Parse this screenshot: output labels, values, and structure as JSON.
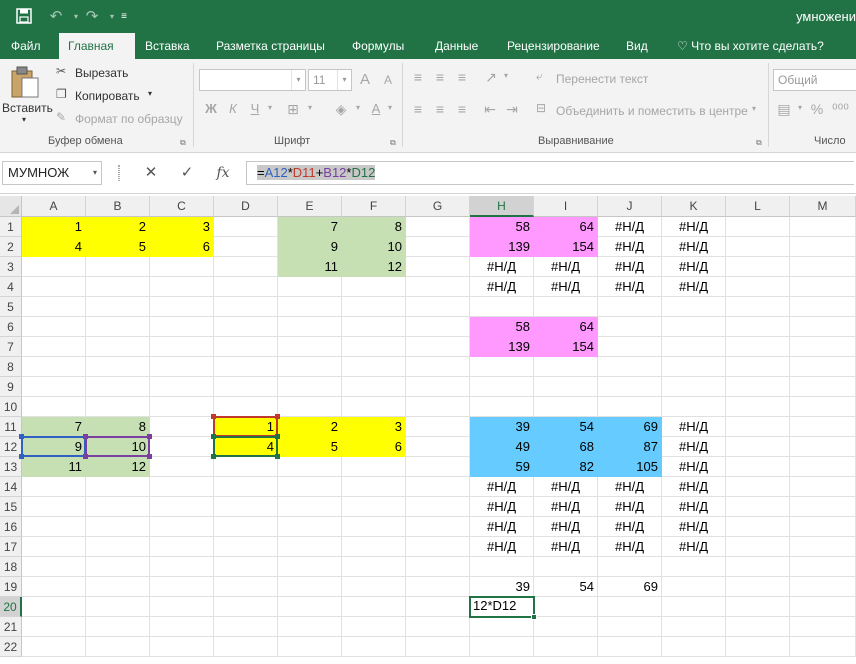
{
  "app": {
    "title": "умножени",
    "colors": {
      "accent": "#217346",
      "yellow": "#ffff00",
      "green": "#c6e0b4",
      "pink": "#ff99ff",
      "blue": "#66ccff"
    }
  },
  "qat": {
    "save_icon": "save-icon",
    "undo_icon": "undo-icon",
    "redo_icon": "redo-icon",
    "customize_icon": "customize-qat-icon"
  },
  "tabs": [
    "Файл",
    "Главная",
    "Вставка",
    "Разметка страницы",
    "Формулы",
    "Данные",
    "Рецензирование",
    "Вид"
  ],
  "tell_me": "Что вы хотите сделать?",
  "ribbon": {
    "clipboard": {
      "paste": "Вставить",
      "cut": "Вырезать",
      "copy": "Копировать",
      "format_painter": "Формат по образцу",
      "label": "Буфер обмена"
    },
    "font": {
      "name": "",
      "size": "11",
      "bold": "Ж",
      "italic": "К",
      "underline": "Ч",
      "grow": "A",
      "shrink": "A",
      "color": "A",
      "label": "Шрифт"
    },
    "alignment": {
      "wrap": "Перенести текст",
      "merge": "Объединить и поместить в центре",
      "label": "Выравнивание"
    },
    "number": {
      "format": "Общий",
      "percent": "%",
      "label": "Число"
    }
  },
  "formula_bar": {
    "name_box": "МУМНОЖ",
    "cancel": "✕",
    "enter": "✓",
    "fx": "fx",
    "formula_parts": [
      {
        "text": "=",
        "color": "#000000"
      },
      {
        "text": "A12",
        "color": "#3060c0"
      },
      {
        "text": "*",
        "color": "#000000"
      },
      {
        "text": "D11",
        "color": "#c0392b"
      },
      {
        "text": "+",
        "color": "#000000"
      },
      {
        "text": "B12",
        "color": "#7a3fa0"
      },
      {
        "text": "*",
        "color": "#000000"
      },
      {
        "text": "D12",
        "color": "#217346"
      }
    ]
  },
  "sheet": {
    "columns": [
      "A",
      "B",
      "C",
      "D",
      "E",
      "F",
      "G",
      "H",
      "I",
      "J",
      "K",
      "L",
      "M"
    ],
    "rows": [
      "1",
      "2",
      "3",
      "4",
      "5",
      "6",
      "7",
      "8",
      "9",
      "10",
      "11",
      "12",
      "13",
      "14",
      "15",
      "16",
      "17",
      "18",
      "19",
      "20",
      "21",
      "22"
    ],
    "selected_column": "H",
    "selected_row": "20",
    "active_cell": {
      "ref": "H20",
      "text": "12*D12"
    },
    "cells": [
      {
        "ref": "A1",
        "v": "1",
        "bg": "y"
      },
      {
        "ref": "B1",
        "v": "2",
        "bg": "y"
      },
      {
        "ref": "C1",
        "v": "3",
        "bg": "y"
      },
      {
        "ref": "A2",
        "v": "4",
        "bg": "y"
      },
      {
        "ref": "B2",
        "v": "5",
        "bg": "y"
      },
      {
        "ref": "C2",
        "v": "6",
        "bg": "y"
      },
      {
        "ref": "E1",
        "v": "7",
        "bg": "g"
      },
      {
        "ref": "F1",
        "v": "8",
        "bg": "g"
      },
      {
        "ref": "E2",
        "v": "9",
        "bg": "g"
      },
      {
        "ref": "F2",
        "v": "10",
        "bg": "g"
      },
      {
        "ref": "E3",
        "v": "11",
        "bg": "g"
      },
      {
        "ref": "F3",
        "v": "12",
        "bg": "g"
      },
      {
        "ref": "H1",
        "v": "58",
        "bg": "p"
      },
      {
        "ref": "I1",
        "v": "64",
        "bg": "p"
      },
      {
        "ref": "J1",
        "v": "#Н/Д",
        "c": 1
      },
      {
        "ref": "K1",
        "v": "#Н/Д",
        "c": 1
      },
      {
        "ref": "H2",
        "v": "139",
        "bg": "p"
      },
      {
        "ref": "I2",
        "v": "154",
        "bg": "p"
      },
      {
        "ref": "J2",
        "v": "#Н/Д",
        "c": 1
      },
      {
        "ref": "K2",
        "v": "#Н/Д",
        "c": 1
      },
      {
        "ref": "H3",
        "v": "#Н/Д",
        "c": 1
      },
      {
        "ref": "I3",
        "v": "#Н/Д",
        "c": 1
      },
      {
        "ref": "J3",
        "v": "#Н/Д",
        "c": 1
      },
      {
        "ref": "K3",
        "v": "#Н/Д",
        "c": 1
      },
      {
        "ref": "H4",
        "v": "#Н/Д",
        "c": 1
      },
      {
        "ref": "I4",
        "v": "#Н/Д",
        "c": 1
      },
      {
        "ref": "J4",
        "v": "#Н/Д",
        "c": 1
      },
      {
        "ref": "K4",
        "v": "#Н/Д",
        "c": 1
      },
      {
        "ref": "H6",
        "v": "58",
        "bg": "p"
      },
      {
        "ref": "I6",
        "v": "64",
        "bg": "p"
      },
      {
        "ref": "H7",
        "v": "139",
        "bg": "p"
      },
      {
        "ref": "I7",
        "v": "154",
        "bg": "p"
      },
      {
        "ref": "A11",
        "v": "7",
        "bg": "g"
      },
      {
        "ref": "B11",
        "v": "8",
        "bg": "g"
      },
      {
        "ref": "A12",
        "v": "9",
        "bg": "g"
      },
      {
        "ref": "B12",
        "v": "10",
        "bg": "g"
      },
      {
        "ref": "A13",
        "v": "11",
        "bg": "g"
      },
      {
        "ref": "B13",
        "v": "12",
        "bg": "g"
      },
      {
        "ref": "D11",
        "v": "1",
        "bg": "y"
      },
      {
        "ref": "E11",
        "v": "2",
        "bg": "y"
      },
      {
        "ref": "F11",
        "v": "3",
        "bg": "y"
      },
      {
        "ref": "D12",
        "v": "4",
        "bg": "y"
      },
      {
        "ref": "E12",
        "v": "5",
        "bg": "y"
      },
      {
        "ref": "F12",
        "v": "6",
        "bg": "y"
      },
      {
        "ref": "H11",
        "v": "39",
        "bg": "b"
      },
      {
        "ref": "I11",
        "v": "54",
        "bg": "b"
      },
      {
        "ref": "J11",
        "v": "69",
        "bg": "b"
      },
      {
        "ref": "K11",
        "v": "#Н/Д",
        "c": 1
      },
      {
        "ref": "H12",
        "v": "49",
        "bg": "b"
      },
      {
        "ref": "I12",
        "v": "68",
        "bg": "b"
      },
      {
        "ref": "J12",
        "v": "87",
        "bg": "b"
      },
      {
        "ref": "K12",
        "v": "#Н/Д",
        "c": 1
      },
      {
        "ref": "H13",
        "v": "59",
        "bg": "b"
      },
      {
        "ref": "I13",
        "v": "82",
        "bg": "b"
      },
      {
        "ref": "J13",
        "v": "105",
        "bg": "b"
      },
      {
        "ref": "K13",
        "v": "#Н/Д",
        "c": 1
      },
      {
        "ref": "H14",
        "v": "#Н/Д",
        "c": 1
      },
      {
        "ref": "I14",
        "v": "#Н/Д",
        "c": 1
      },
      {
        "ref": "J14",
        "v": "#Н/Д",
        "c": 1
      },
      {
        "ref": "K14",
        "v": "#Н/Д",
        "c": 1
      },
      {
        "ref": "H15",
        "v": "#Н/Д",
        "c": 1
      },
      {
        "ref": "I15",
        "v": "#Н/Д",
        "c": 1
      },
      {
        "ref": "J15",
        "v": "#Н/Д",
        "c": 1
      },
      {
        "ref": "K15",
        "v": "#Н/Д",
        "c": 1
      },
      {
        "ref": "H16",
        "v": "#Н/Д",
        "c": 1
      },
      {
        "ref": "I16",
        "v": "#Н/Д",
        "c": 1
      },
      {
        "ref": "J16",
        "v": "#Н/Д",
        "c": 1
      },
      {
        "ref": "K16",
        "v": "#Н/Д",
        "c": 1
      },
      {
        "ref": "H17",
        "v": "#Н/Д",
        "c": 1
      },
      {
        "ref": "I17",
        "v": "#Н/Д",
        "c": 1
      },
      {
        "ref": "J17",
        "v": "#Н/Д",
        "c": 1
      },
      {
        "ref": "K17",
        "v": "#Н/Д",
        "c": 1
      },
      {
        "ref": "H19",
        "v": "39"
      },
      {
        "ref": "I19",
        "v": "54"
      },
      {
        "ref": "J19",
        "v": "69"
      }
    ],
    "ref_highlights": [
      {
        "ref": "A12",
        "color": "#3060c0"
      },
      {
        "ref": "D11",
        "color": "#c0392b"
      },
      {
        "ref": "B12",
        "color": "#7a3fa0"
      },
      {
        "ref": "D12",
        "color": "#217346"
      }
    ]
  }
}
